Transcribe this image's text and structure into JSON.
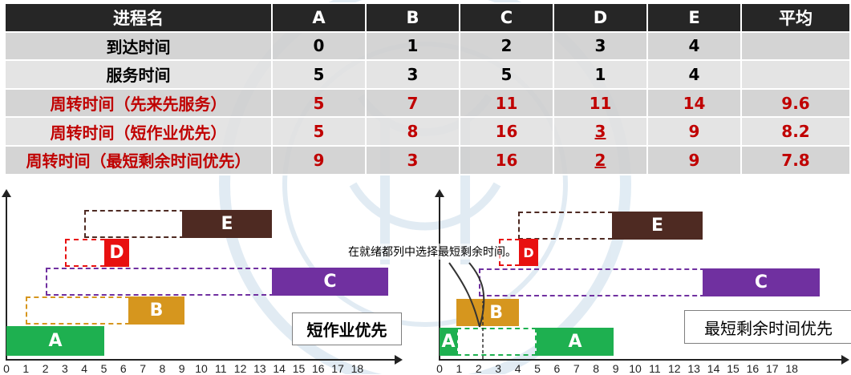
{
  "table": {
    "headers": [
      "进程名",
      "A",
      "B",
      "C",
      "D",
      "E",
      "平均"
    ],
    "rows": [
      {
        "label": "到达时间",
        "cells": [
          "0",
          "1",
          "2",
          "3",
          "4",
          ""
        ]
      },
      {
        "label": "服务时间",
        "cells": [
          "5",
          "3",
          "5",
          "1",
          "4",
          ""
        ]
      },
      {
        "label": "周转时间（先来先服务）",
        "cells": [
          "5",
          "7",
          "11",
          "11",
          "14",
          "9.6"
        ]
      },
      {
        "label": "周转时间（短作业优先）",
        "cells": [
          "5",
          "8",
          "16",
          "3",
          "9",
          "8.2"
        ]
      },
      {
        "label": "周转时间（最短剩余时间优先）",
        "cells": [
          "9",
          "3",
          "16",
          "2",
          "9",
          "7.8"
        ]
      }
    ]
  },
  "charts": {
    "left": {
      "title": "短作业优先",
      "ticks": [
        "0",
        "1",
        "2",
        "3",
        "4",
        "5",
        "6",
        "7",
        "8",
        "9",
        "10",
        "11",
        "12",
        "13",
        "14",
        "15",
        "16",
        "17",
        "18"
      ],
      "bars": [
        {
          "name": "A",
          "color": "#1eb050"
        },
        {
          "name": "B",
          "color": "#d6961e"
        },
        {
          "name": "C",
          "color": "#7030a0"
        },
        {
          "name": "D",
          "color": "#e81010"
        },
        {
          "name": "E",
          "color": "#4e2a22"
        }
      ]
    },
    "right": {
      "title": "最短剩余时间优先",
      "note": "在就绪都列中选择最短剩余时间。",
      "ticks": [
        "0",
        "1",
        "2",
        "3",
        "4",
        "5",
        "6",
        "7",
        "8",
        "9",
        "10",
        "11",
        "12",
        "13",
        "14",
        "15",
        "16",
        "17",
        "18"
      ],
      "bars": [
        {
          "name": "A",
          "color": "#1eb050"
        },
        {
          "name": "B",
          "color": "#d6961e"
        },
        {
          "name": "A",
          "color": "#1eb050"
        },
        {
          "name": "D",
          "color": "#e81010"
        },
        {
          "name": "E",
          "color": "#4e2a22"
        },
        {
          "name": "C",
          "color": "#7030a0"
        }
      ]
    }
  }
}
